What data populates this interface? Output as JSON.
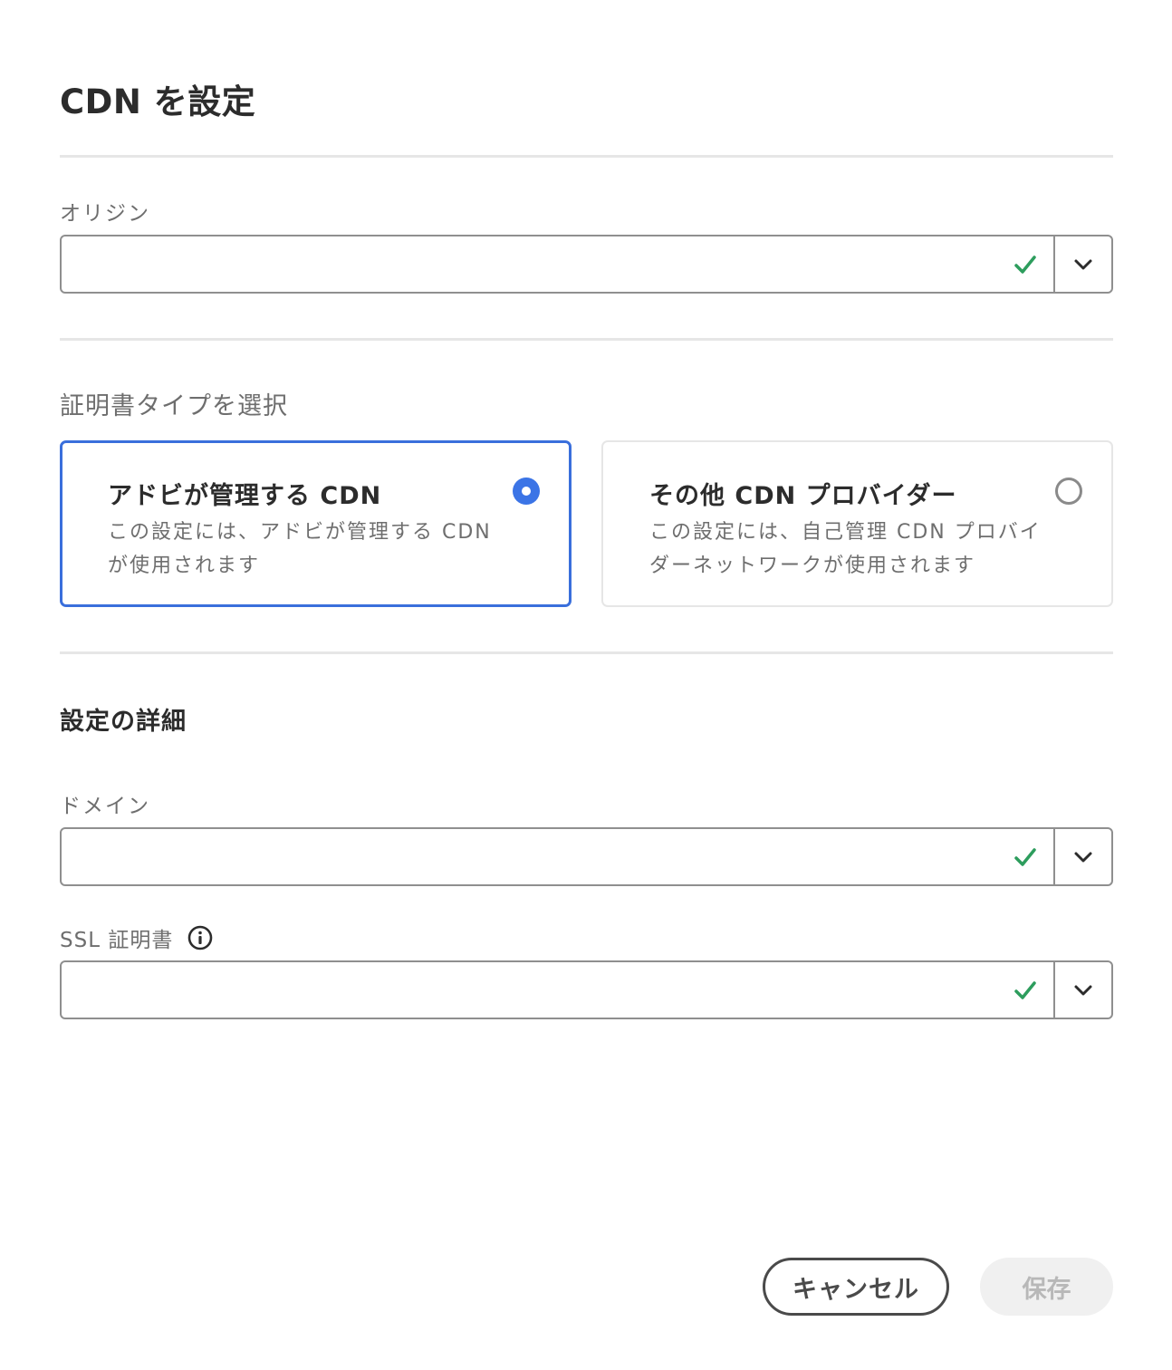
{
  "dialog": {
    "title": "CDN を設定"
  },
  "origin": {
    "label": "オリジン",
    "value": ""
  },
  "certificate_type": {
    "label": "証明書タイプを選択",
    "options": [
      {
        "title": "アドビが管理する CDN",
        "description": "この設定には、アドビが管理する CDN が使用されます",
        "selected": true
      },
      {
        "title": "その他 CDN プロバイダー",
        "description": "この設定には、自己管理 CDN プロバイダーネットワークが使用されます",
        "selected": false
      }
    ]
  },
  "details": {
    "title": "設定の詳細",
    "domain": {
      "label": "ドメイン",
      "value": ""
    },
    "ssl": {
      "label": "SSL 証明書",
      "value": ""
    }
  },
  "footer": {
    "cancel_label": "キャンセル",
    "save_label": "保存"
  },
  "colors": {
    "accent": "#3b74e6",
    "valid_check": "#2d9d5d",
    "border": "#8f8f8f"
  },
  "icons": {
    "valid": "checkmark-icon",
    "picker": "chevron-down-icon",
    "info": "info-icon"
  }
}
